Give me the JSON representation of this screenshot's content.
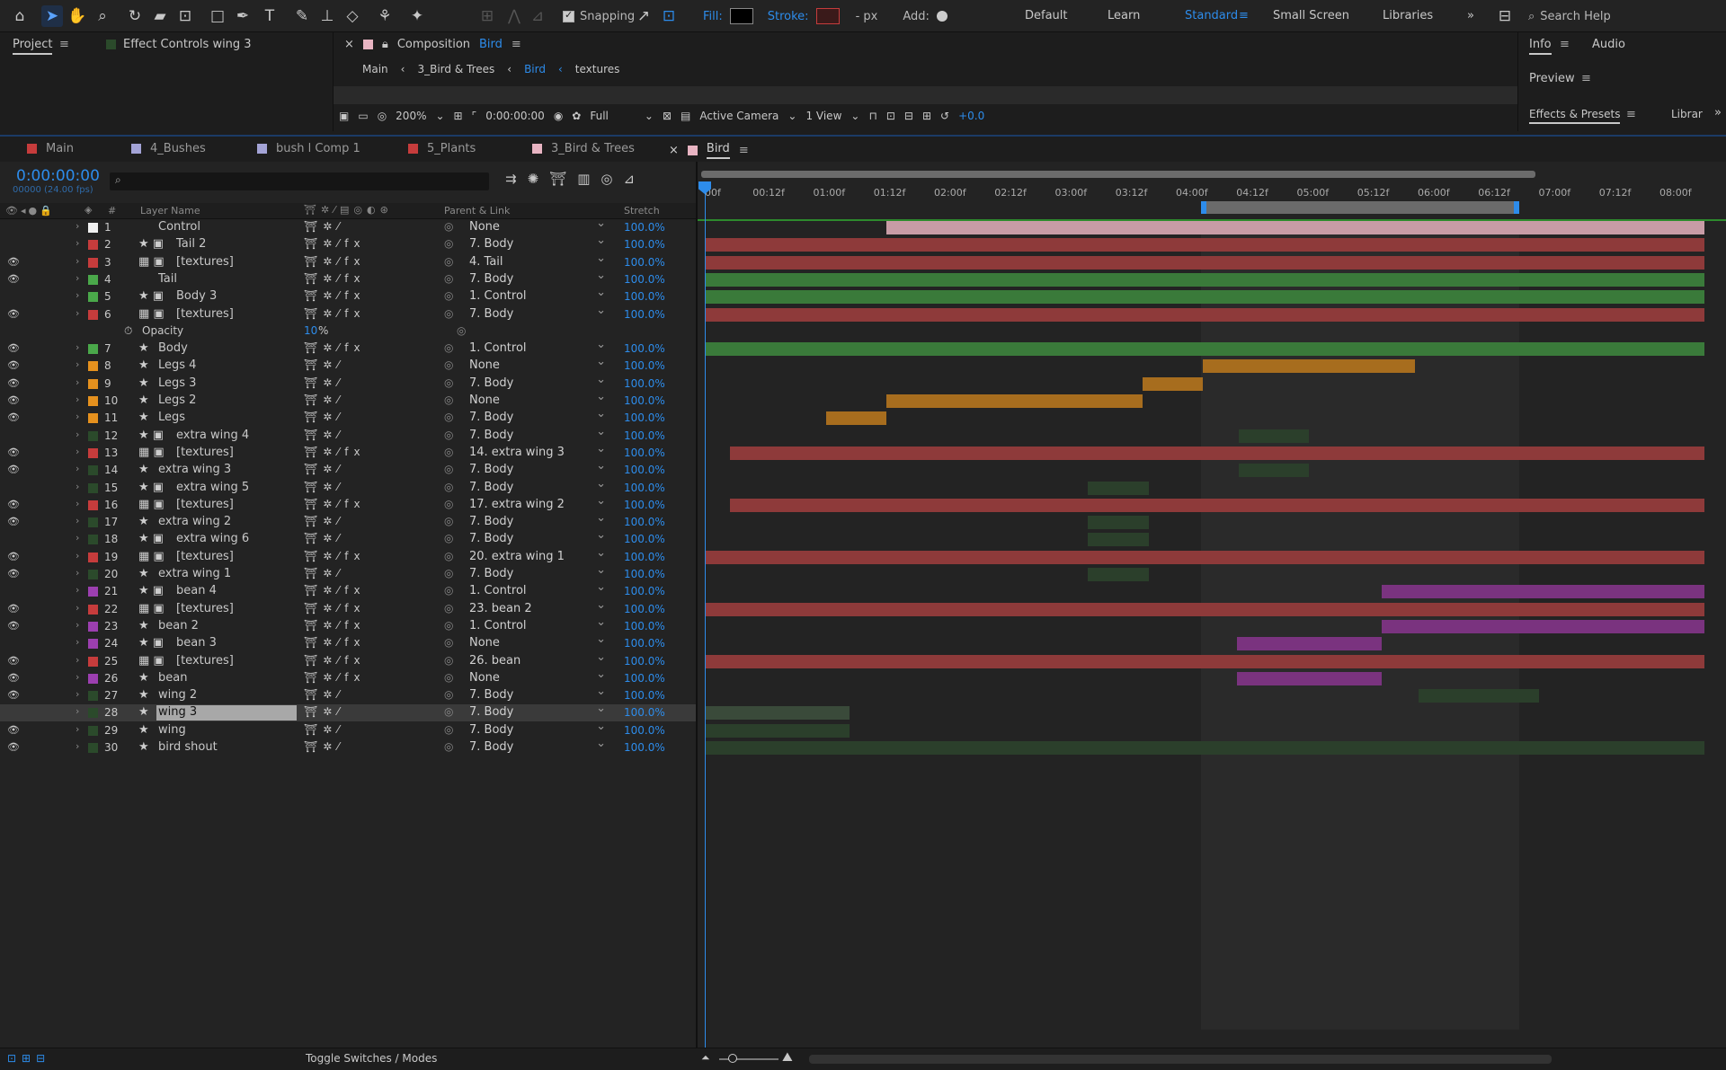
{
  "toolbar": {
    "snapping_label": "Snapping",
    "fill_label": "Fill:",
    "stroke_label": "Stroke:",
    "px_label": "- px",
    "add_label": "Add:",
    "workspaces": [
      "Default",
      "Learn",
      "Standard",
      "Small Screen",
      "Libraries"
    ],
    "active_workspace": "Standard",
    "search_placeholder": "Search Help"
  },
  "panels": {
    "project_tab": "Project",
    "effect_controls_tab": "Effect Controls  wing 3",
    "composition_tab_prefix": "Composition",
    "composition_name": "Bird",
    "breadcrumbs": [
      "Main",
      "3_Bird & Trees",
      "Bird",
      "textures"
    ],
    "info_tab": "Info",
    "audio_tab": "Audio",
    "preview_tab": "Preview",
    "effects_tab": "Effects & Presets",
    "libraries_tab": "Librar",
    "viewer": {
      "zoom": "200%",
      "timecode": "0:00:00:00",
      "resolution": "Full",
      "camera": "Active Camera",
      "views": "1 View",
      "exposure": "+0.0"
    }
  },
  "comp_tabs": [
    {
      "label": "Main",
      "color": "#c63c3c"
    },
    {
      "label": "4_Bushes",
      "color": "#a3a3d6"
    },
    {
      "label": "bush l Comp 1",
      "color": "#a3a3d6"
    },
    {
      "label": "5_Plants",
      "color": "#c63c3c"
    },
    {
      "label": "3_Bird & Trees",
      "color": "#e8b4c2"
    },
    {
      "label": "Bird",
      "color": "#e8b4c2"
    }
  ],
  "timeline": {
    "timecode": "0:00:00:00",
    "fps_info": "00000 (24.00 fps)",
    "col_layer_name": "Layer Name",
    "col_parent": "Parent & Link",
    "col_stretch": "Stretch",
    "ruler": [
      "00f",
      "00:12f",
      "01:00f",
      "01:12f",
      "02:00f",
      "02:12f",
      "03:00f",
      "03:12f",
      "04:00f",
      "04:12f",
      "05:00f",
      "05:12f",
      "06:00f",
      "06:12f",
      "07:00f",
      "07:12f",
      "08:00f"
    ],
    "opacity_label": "Opacity",
    "opacity_value": "10",
    "opacity_unit": "%",
    "layers": [
      {
        "num": "1",
        "name": "Control",
        "color": "#f0f0f0",
        "parent": "None",
        "stretch": "100.0%",
        "eye": false,
        "icon": "none",
        "fx": false,
        "bar": {
          "start": 1.5,
          "end": 8.3,
          "color": "#c89ca6"
        }
      },
      {
        "num": "2",
        "name": "Tail 2",
        "color": "#c63c3c",
        "parent": "7. Body",
        "stretch": "100.0%",
        "eye": false,
        "icon": "star-precomp",
        "fx": true,
        "bar": {
          "start": 0,
          "end": 8.3,
          "color": "#8e3a3a"
        }
      },
      {
        "num": "3",
        "name": "[textures]",
        "color": "#c63c3c",
        "parent": "4. Tail",
        "stretch": "100.0%",
        "eye": true,
        "icon": "comp",
        "fx": true,
        "bar": {
          "start": 0,
          "end": 8.3,
          "color": "#8e3a3a"
        }
      },
      {
        "num": "4",
        "name": "Tail",
        "color": "#4aa84a",
        "parent": "7. Body",
        "stretch": "100.0%",
        "eye": true,
        "icon": "none",
        "fx": true,
        "bar": {
          "start": 0,
          "end": 8.3,
          "color": "#3a7a3a"
        }
      },
      {
        "num": "5",
        "name": "Body 3",
        "color": "#4aa84a",
        "parent": "1. Control",
        "stretch": "100.0%",
        "eye": false,
        "icon": "star-precomp",
        "fx": true,
        "bar": {
          "start": 0,
          "end": 8.3,
          "color": "#3a7a3a"
        }
      },
      {
        "num": "6",
        "name": "[textures]",
        "color": "#c63c3c",
        "parent": "7. Body",
        "stretch": "100.0%",
        "eye": true,
        "icon": "comp",
        "fx": true,
        "bar": {
          "start": 0,
          "end": 8.3,
          "color": "#8e3a3a"
        }
      },
      {
        "num": "7",
        "name": "Body",
        "color": "#4aa84a",
        "parent": "1. Control",
        "stretch": "100.0%",
        "eye": true,
        "icon": "star",
        "fx": true,
        "bar": {
          "start": 0,
          "end": 8.3,
          "color": "#3a7a3a"
        }
      },
      {
        "num": "8",
        "name": "Legs 4",
        "color": "#e5911e",
        "parent": "None",
        "stretch": "100.0%",
        "eye": true,
        "icon": "star",
        "fx": false,
        "bar": {
          "start": 4.12,
          "end": 5.87,
          "color": "#a76d1e"
        }
      },
      {
        "num": "9",
        "name": "Legs 3",
        "color": "#e5911e",
        "parent": "7. Body",
        "stretch": "100.0%",
        "eye": true,
        "icon": "star",
        "fx": false,
        "bar": {
          "start": 3.62,
          "end": 4.12,
          "color": "#a76d1e"
        }
      },
      {
        "num": "10",
        "name": "Legs 2",
        "color": "#e5911e",
        "parent": "None",
        "stretch": "100.0%",
        "eye": true,
        "icon": "star",
        "fx": false,
        "bar": {
          "start": 1.5,
          "end": 3.62,
          "color": "#a76d1e"
        }
      },
      {
        "num": "11",
        "name": "Legs",
        "color": "#e5911e",
        "parent": "7. Body",
        "stretch": "100.0%",
        "eye": true,
        "icon": "star",
        "fx": false,
        "bar": {
          "start": 1.0,
          "end": 1.5,
          "color": "#a76d1e"
        }
      },
      {
        "num": "12",
        "name": "extra wing 4",
        "color": "#2b4a2b",
        "parent": "7. Body",
        "stretch": "100.0%",
        "eye": false,
        "icon": "star-precomp",
        "fx": false,
        "bar": {
          "start": 4.42,
          "end": 5.0,
          "color": "#2b3f2b"
        }
      },
      {
        "num": "13",
        "name": "[textures]",
        "color": "#c63c3c",
        "parent": "14. extra wing 3",
        "stretch": "100.0%",
        "eye": true,
        "icon": "comp",
        "fx": true,
        "bar": {
          "start": 0.21,
          "end": 8.3,
          "color": "#8e3a3a"
        }
      },
      {
        "num": "14",
        "name": "extra wing 3",
        "color": "#2b4a2b",
        "parent": "7. Body",
        "stretch": "100.0%",
        "eye": true,
        "icon": "star",
        "fx": false,
        "bar": {
          "start": 4.42,
          "end": 5.0,
          "color": "#2b3f2b"
        }
      },
      {
        "num": "15",
        "name": "extra wing 5",
        "color": "#2b4a2b",
        "parent": "7. Body",
        "stretch": "100.0%",
        "eye": false,
        "icon": "star-precomp",
        "fx": false,
        "bar": {
          "start": 3.17,
          "end": 3.67,
          "color": "#2b3f2b"
        }
      },
      {
        "num": "16",
        "name": "[textures]",
        "color": "#c63c3c",
        "parent": "17. extra wing 2",
        "stretch": "100.0%",
        "eye": true,
        "icon": "comp",
        "fx": true,
        "bar": {
          "start": 0.21,
          "end": 8.3,
          "color": "#8e3a3a"
        }
      },
      {
        "num": "17",
        "name": "extra wing 2",
        "color": "#2b4a2b",
        "parent": "7. Body",
        "stretch": "100.0%",
        "eye": true,
        "icon": "star",
        "fx": false,
        "bar": {
          "start": 3.17,
          "end": 3.67,
          "color": "#2b3f2b"
        }
      },
      {
        "num": "18",
        "name": "extra wing 6",
        "color": "#2b4a2b",
        "parent": "7. Body",
        "stretch": "100.0%",
        "eye": false,
        "icon": "star-precomp",
        "fx": false,
        "bar": {
          "start": 3.17,
          "end": 3.67,
          "color": "#2b3f2b"
        }
      },
      {
        "num": "19",
        "name": "[textures]",
        "color": "#c63c3c",
        "parent": "20. extra wing 1",
        "stretch": "100.0%",
        "eye": true,
        "icon": "comp",
        "fx": true,
        "bar": {
          "start": 0,
          "end": 8.3,
          "color": "#8e3a3a"
        }
      },
      {
        "num": "20",
        "name": "extra wing 1",
        "color": "#2b4a2b",
        "parent": "7. Body",
        "stretch": "100.0%",
        "eye": true,
        "icon": "star",
        "fx": false,
        "bar": {
          "start": 3.17,
          "end": 3.67,
          "color": "#2b3f2b"
        }
      },
      {
        "num": "21",
        "name": "bean 4",
        "color": "#9c3fb0",
        "parent": "1. Control",
        "stretch": "100.0%",
        "eye": false,
        "icon": "star-precomp",
        "fx": true,
        "bar": {
          "start": 5.6,
          "end": 8.3,
          "color": "#7a337f"
        }
      },
      {
        "num": "22",
        "name": "[textures]",
        "color": "#c63c3c",
        "parent": "23. bean 2",
        "stretch": "100.0%",
        "eye": true,
        "icon": "comp",
        "fx": true,
        "bar": {
          "start": 0,
          "end": 8.3,
          "color": "#8e3a3a"
        }
      },
      {
        "num": "23",
        "name": "bean 2",
        "color": "#9c3fb0",
        "parent": "1. Control",
        "stretch": "100.0%",
        "eye": true,
        "icon": "star",
        "fx": true,
        "bar": {
          "start": 5.6,
          "end": 8.3,
          "color": "#7a337f"
        }
      },
      {
        "num": "24",
        "name": "bean 3",
        "color": "#9c3fb0",
        "parent": "None",
        "stretch": "100.0%",
        "eye": false,
        "icon": "star-precomp",
        "fx": true,
        "bar": {
          "start": 4.4,
          "end": 5.6,
          "color": "#7a337f"
        }
      },
      {
        "num": "25",
        "name": "[textures]",
        "color": "#c63c3c",
        "parent": "26. bean",
        "stretch": "100.0%",
        "eye": true,
        "icon": "comp",
        "fx": true,
        "bar": {
          "start": 0,
          "end": 8.3,
          "color": "#8e3a3a"
        }
      },
      {
        "num": "26",
        "name": "bean",
        "color": "#9c3fb0",
        "parent": "None",
        "stretch": "100.0%",
        "eye": true,
        "icon": "star",
        "fx": true,
        "bar": {
          "start": 4.4,
          "end": 5.6,
          "color": "#7a337f"
        }
      },
      {
        "num": "27",
        "name": "wing 2",
        "color": "#2b4a2b",
        "parent": "7. Body",
        "stretch": "100.0%",
        "eye": true,
        "icon": "star",
        "fx": false,
        "bar": {
          "start": 5.9,
          "end": 6.9,
          "color": "#2b3f2b"
        }
      },
      {
        "num": "28",
        "name": "wing 3",
        "color": "#2b4a2b",
        "parent": "7. Body",
        "stretch": "100.0%",
        "eye": false,
        "icon": "star",
        "fx": false,
        "selected": true,
        "bar": {
          "start": 0,
          "end": 1.2,
          "color": "#3a4a3a"
        }
      },
      {
        "num": "29",
        "name": "wing",
        "color": "#2b4a2b",
        "parent": "7. Body",
        "stretch": "100.0%",
        "eye": true,
        "icon": "star",
        "fx": false,
        "bar": {
          "start": 0,
          "end": 1.2,
          "color": "#2b3f2b"
        }
      },
      {
        "num": "30",
        "name": "bird shout",
        "color": "#2b4a2b",
        "parent": "7. Body",
        "stretch": "100.0%",
        "eye": true,
        "icon": "star",
        "fx": false,
        "bar": {
          "start": 0,
          "end": 8.3,
          "color": "#2b3f2b"
        }
      }
    ]
  },
  "footer": {
    "toggle_label": "Toggle Switches / Modes"
  }
}
